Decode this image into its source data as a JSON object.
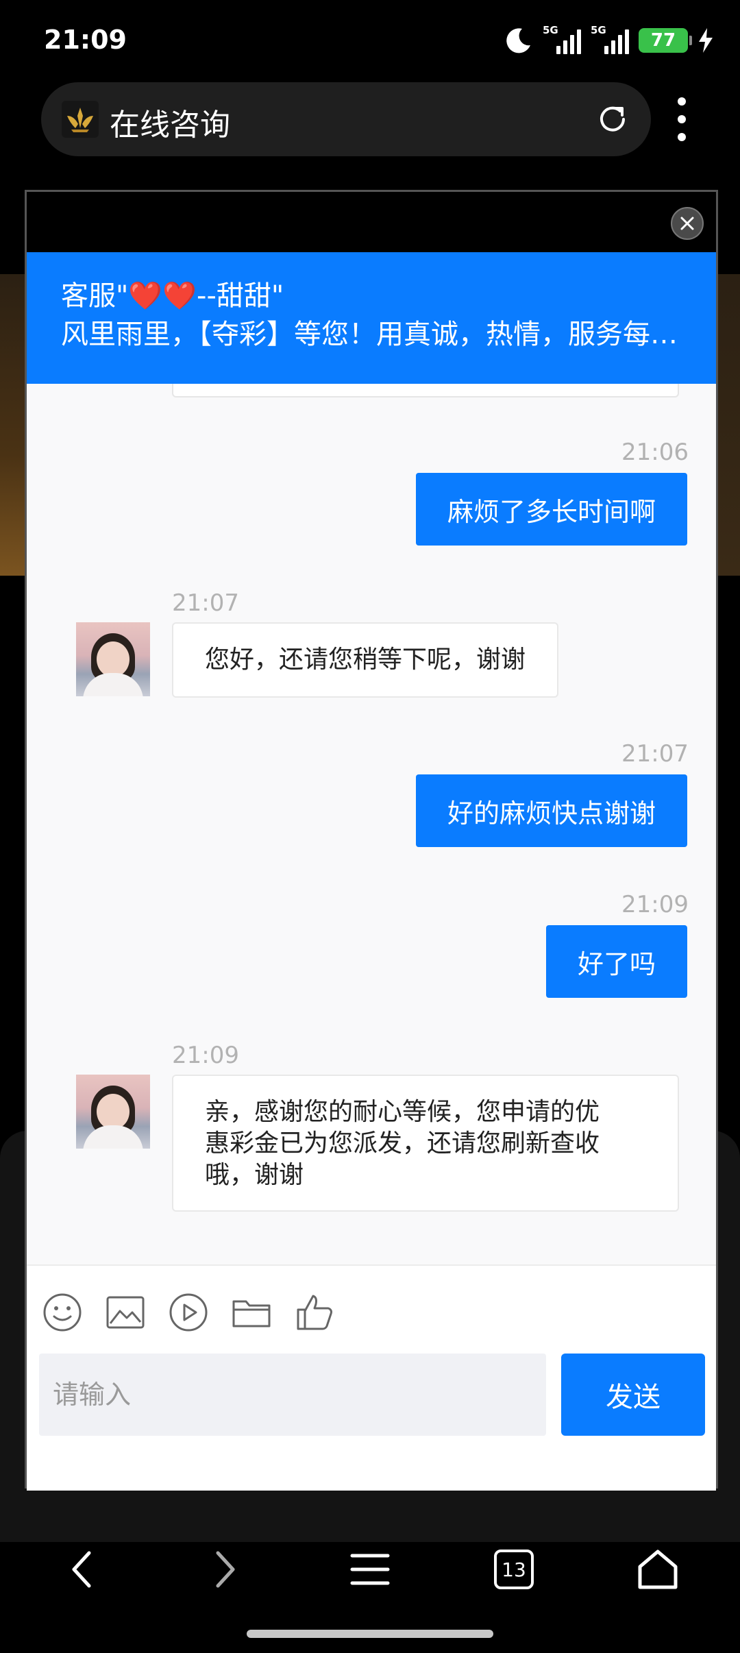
{
  "status_bar": {
    "time": "21:09",
    "signal_1_label": "5G",
    "signal_2_label": "5G",
    "battery": "77",
    "icons": [
      "moon-icon",
      "signal-icon",
      "signal-icon",
      "battery-icon",
      "charging-icon"
    ]
  },
  "browser": {
    "page_title": "在线咨询",
    "tab_count": "13",
    "icons": [
      "site-logo",
      "reload-icon",
      "menu-icon",
      "back-icon",
      "forward-icon",
      "menu-list-icon",
      "tabs-icon",
      "home-icon"
    ]
  },
  "chat": {
    "agent_name": "客服\"❤️❤️--甜甜\"",
    "agent_motto": "风里雨里，【夺彩】等您！用真诚，热情，服务每一位客户",
    "messages": [
      {
        "side": "out",
        "time": "21:06",
        "text": "麻烦了多长时间啊"
      },
      {
        "side": "in",
        "time": "21:07",
        "text": "您好，还请您稍等下呢，谢谢"
      },
      {
        "side": "out",
        "time": "21:07",
        "text": "好的麻烦快点谢谢"
      },
      {
        "side": "out",
        "time": "21:09",
        "text": "好了吗"
      },
      {
        "side": "in",
        "time": "21:09",
        "lines": [
          "亲，感谢您的耐心等候，您申请的优",
          "惠彩金已为您派发，还请您刷新查收",
          "哦，谢谢"
        ]
      }
    ],
    "input_placeholder": "请输入",
    "send_label": "发送",
    "toolbar_icons": [
      "emoji-icon",
      "image-icon",
      "video-icon",
      "folder-icon",
      "thumbs-up-icon"
    ]
  },
  "colors": {
    "accent": "#0a7cff",
    "battery": "#39c14a"
  }
}
